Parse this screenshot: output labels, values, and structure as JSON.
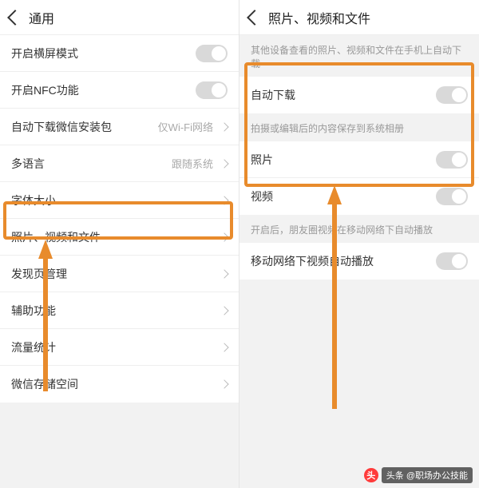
{
  "left": {
    "title": "通用",
    "rows": [
      {
        "label": "开启横屏模式",
        "type": "toggle"
      },
      {
        "label": "开启NFC功能",
        "type": "toggle"
      },
      {
        "label": "自动下载微信安装包",
        "type": "value",
        "value": "仅Wi-Fi网络"
      },
      {
        "label": "多语言",
        "type": "value",
        "value": "跟随系统"
      },
      {
        "label": "字体大小",
        "type": "chevron"
      },
      {
        "label": "照片、视频和文件",
        "type": "chevron"
      },
      {
        "label": "发现页管理",
        "type": "chevron"
      },
      {
        "label": "辅助功能",
        "type": "chevron"
      },
      {
        "label": "流量统计",
        "type": "chevron"
      },
      {
        "label": "微信存储空间",
        "type": "chevron"
      }
    ]
  },
  "right": {
    "title": "照片、视频和文件",
    "note1": "其他设备查看的照片、视频和文件在手机上自动下载",
    "rows1": [
      {
        "label": "自动下载",
        "type": "toggle"
      }
    ],
    "note2": "拍摄或编辑后的内容保存到系统相册",
    "rows2": [
      {
        "label": "照片",
        "type": "toggle"
      },
      {
        "label": "视频",
        "type": "toggle"
      }
    ],
    "note3": "开启后，朋友圈视频在移动网络下自动播放",
    "rows3": [
      {
        "label": "移动网络下视频自动播放",
        "type": "toggle"
      }
    ]
  },
  "watermark": {
    "badge": "头",
    "text": "头条 @职场办公技能"
  }
}
